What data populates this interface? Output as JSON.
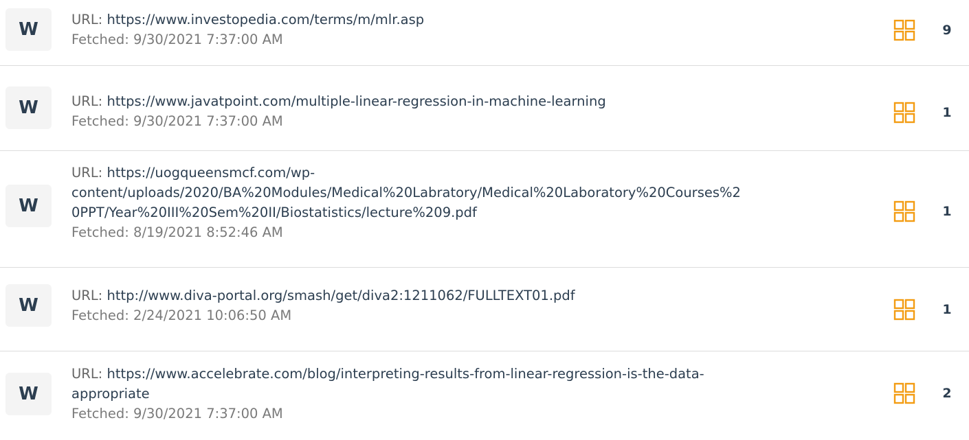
{
  "labels": {
    "url_prefix": "URL: ",
    "fetched_prefix": "Fetched: "
  },
  "colors": {
    "accent": "#f39c12",
    "badge_bg": "#f4f4f4",
    "text_dark": "#2c3e50"
  },
  "sources": [
    {
      "badge": "W",
      "url": "https://www.investopedia.com/terms/m/mlr.asp",
      "fetched": "9/30/2021 7:37:00 AM",
      "icon": "grid-icon",
      "count": "9"
    },
    {
      "badge": "W",
      "url": "https://www.javatpoint.com/multiple-linear-regression-in-machine-learning",
      "fetched": "9/30/2021 7:37:00 AM",
      "icon": "grid-icon",
      "count": "1"
    },
    {
      "badge": "W",
      "url": "https://uogqueensmcf.com/wp-content/uploads/2020/BA%20Modules/Medical%20Labratory/Medical%20Laboratory%20Courses%20PPT/Year%20III%20Sem%20II/Biostatistics/lecture%209.pdf",
      "url_lines": [
        "https://uogqueensmcf.com/wp-",
        "content/uploads/2020/BA%20Modules/Medical%20Labratory/Medical%20Laboratory%20Courses%2",
        "0PPT/Year%20III%20Sem%20II/Biostatistics/lecture%209.pdf"
      ],
      "fetched": "8/19/2021 8:52:46 AM",
      "icon": "grid-icon",
      "count": "1"
    },
    {
      "badge": "W",
      "url": "http://www.diva-portal.org/smash/get/diva2:1211062/FULLTEXT01.pdf",
      "fetched": "2/24/2021 10:06:50 AM",
      "icon": "grid-icon",
      "count": "1"
    },
    {
      "badge": "W",
      "url": "https://www.accelebrate.com/blog/interpreting-results-from-linear-regression-is-the-data-appropriate",
      "url_lines": [
        "https://www.accelebrate.com/blog/interpreting-results-from-linear-regression-is-the-data-",
        "appropriate"
      ],
      "fetched": "9/30/2021 7:37:00 AM",
      "icon": "grid-icon",
      "count": "2"
    }
  ]
}
